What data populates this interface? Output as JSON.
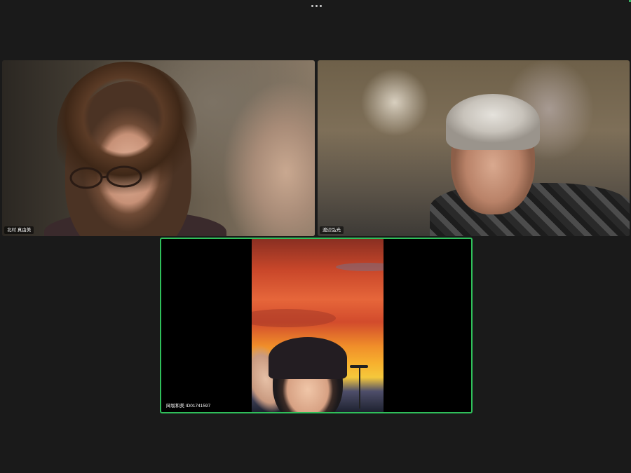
{
  "toolbar": {
    "more_icon": "more-horizontal-icon"
  },
  "status": {
    "indicator_color": "#3ec46d"
  },
  "participants": [
    {
      "name": "北村 真由美"
    },
    {
      "name": "渡辺弘光"
    },
    {
      "name": "岡坂和美 ID01741597",
      "active_speaker": true,
      "highlight_color": "#2fbf5a"
    }
  ]
}
